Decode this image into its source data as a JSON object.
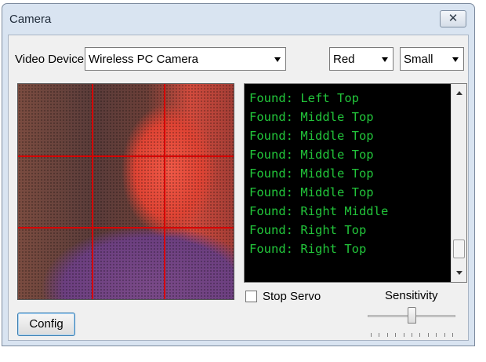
{
  "window": {
    "title": "Camera",
    "close_glyph": "✕"
  },
  "video_device": {
    "label": "Video Device",
    "selected": "Wireless PC Camera"
  },
  "color_select": {
    "selected": "Red"
  },
  "size_select": {
    "selected": "Small"
  },
  "output": {
    "lines": [
      "Found: Left Top",
      "Found: Middle Top",
      "Found: Middle Top",
      "Found: Middle Top",
      "Found: Middle Top",
      "Found: Middle Top",
      "Found: Right Middle",
      "Found: Right Top",
      "Found: Right Top"
    ],
    "text_color": "#22c43a",
    "background": "#000000"
  },
  "stop_servo": {
    "label": "Stop Servo",
    "checked": false
  },
  "sensitivity": {
    "label": "Sensitivity",
    "value_fraction": 0.5
  },
  "config_button": {
    "label": "Config"
  },
  "video": {
    "grid_color": "#d60000"
  },
  "icons": {
    "close": "close-icon",
    "dropdown": "chevron-down-icon"
  }
}
